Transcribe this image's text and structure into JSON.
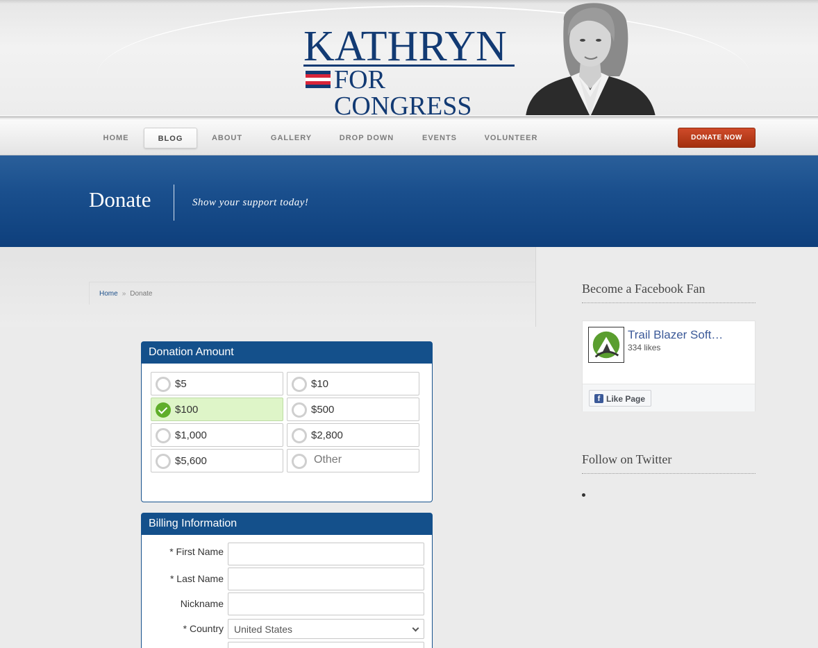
{
  "logo": {
    "line1": "KATHRYN",
    "line2": "FOR CONGRESS"
  },
  "nav": {
    "items": [
      "HOME",
      "BLOG",
      "ABOUT",
      "GALLERY",
      "DROP DOWN",
      "EVENTS",
      "VOLUNTEER"
    ],
    "active": "BLOG",
    "donate_label": "DONATE NOW"
  },
  "banner": {
    "title": "Donate",
    "subtitle": "Show your support today!"
  },
  "breadcrumb": {
    "home": "Home",
    "separator": "»",
    "current": "Donate"
  },
  "donation": {
    "title": "Donation Amount",
    "options": [
      "$5",
      "$10",
      "$100",
      "$500",
      "$1,000",
      "$2,800",
      "$5,600",
      "Other"
    ],
    "selected": "$100"
  },
  "billing": {
    "title": "Billing Information",
    "first_name_label": "* First Name",
    "last_name_label": "* Last Name",
    "nickname_label": "Nickname",
    "country_label": "* Country",
    "country_value": "United States"
  },
  "sidebar": {
    "facebook_title": "Become a Facebook Fan",
    "fb_page_name": "Trail Blazer Soft…",
    "fb_likes": "334 likes",
    "fb_like_button": "Like Page",
    "twitter_title": "Follow on Twitter"
  },
  "colors": {
    "brand_navy": "#123a73",
    "panel_blue": "#14508b",
    "donate_red": "#b83a1a",
    "selected_green": "#def5c8"
  }
}
